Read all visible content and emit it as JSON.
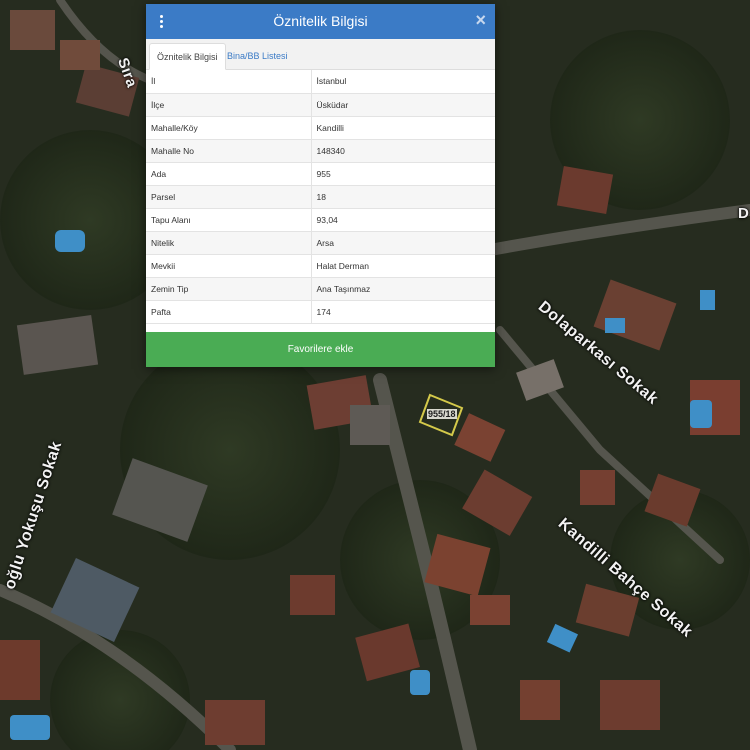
{
  "dialog": {
    "title": "Öznitelik Bilgisi",
    "tabs": [
      {
        "label": "Öznitelik Bilgisi",
        "active": true
      },
      {
        "label": "Bina/BB Listesi",
        "active": false
      }
    ],
    "rows": [
      {
        "key": "İl",
        "value": "İstanbul"
      },
      {
        "key": "İlçe",
        "value": "Üsküdar"
      },
      {
        "key": "Mahalle/Köy",
        "value": "Kandilli"
      },
      {
        "key": "Mahalle No",
        "value": "148340"
      },
      {
        "key": "Ada",
        "value": "955"
      },
      {
        "key": "Parsel",
        "value": "18"
      },
      {
        "key": "Tapu Alanı",
        "value": "93,04"
      },
      {
        "key": "Nitelik",
        "value": "Arsa"
      },
      {
        "key": "Mevkii",
        "value": "Halat Derman"
      },
      {
        "key": "Zemin Tip",
        "value": "Ana Taşınmaz"
      },
      {
        "key": "Pafta",
        "value": "174"
      }
    ],
    "favorite_button": "Favorilere ekle",
    "close_symbol": "×"
  },
  "map": {
    "streets": [
      "Dolaparkası Sokak",
      "Kandilli Bahçe Sokak",
      "oğlu Yokuşu Sokak",
      "Sıra",
      "D"
    ],
    "parcel_label": "955/18"
  },
  "colors": {
    "header": "#3b7bc6",
    "favorite_button": "#4aac54",
    "parcel_outline": "#d4c94a"
  },
  "icons": {
    "menu": "vertical-dots-icon",
    "close": "close-icon"
  }
}
